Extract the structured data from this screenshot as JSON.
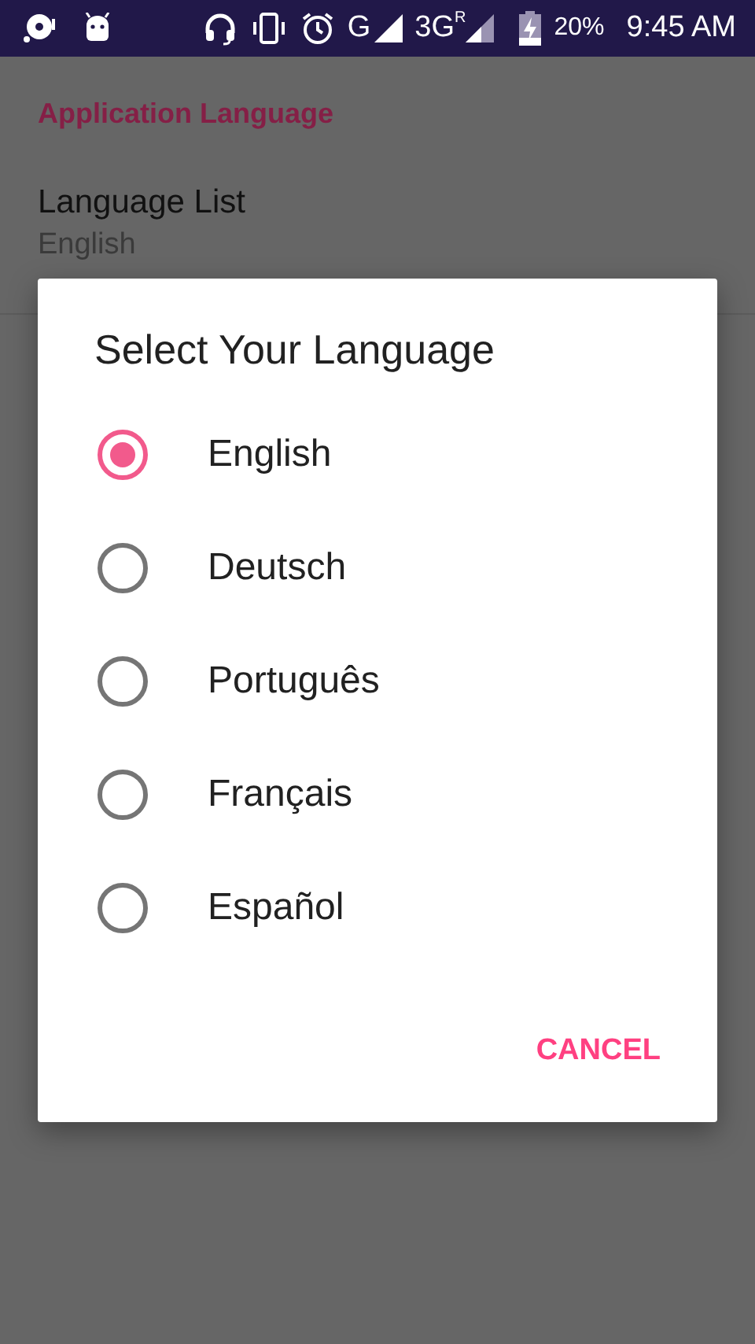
{
  "status_bar": {
    "network": "G",
    "network_2": "3G",
    "roaming": "R",
    "battery": "20%",
    "time": "9:45 AM"
  },
  "settings": {
    "category": "Application Language",
    "preference": {
      "title": "Language List",
      "summary": "English"
    }
  },
  "dialog": {
    "title": "Select Your Language",
    "options": [
      {
        "label": "English",
        "selected": true
      },
      {
        "label": "Deutsch",
        "selected": false
      },
      {
        "label": "Português",
        "selected": false
      },
      {
        "label": "Français",
        "selected": false
      },
      {
        "label": "Español",
        "selected": false
      }
    ],
    "buttons": [
      "CANCEL"
    ]
  }
}
